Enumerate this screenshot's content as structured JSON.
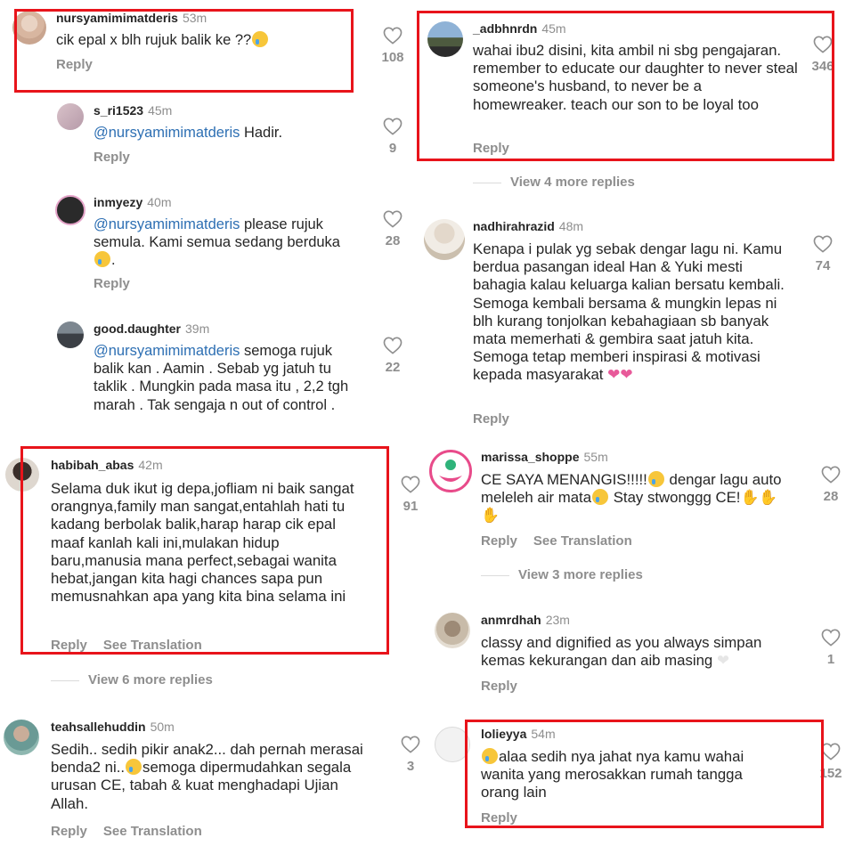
{
  "comments": {
    "c1": {
      "user": "nursyamimimatderis",
      "time": "53m",
      "text": "cik epal x blh rujuk balik ke ??",
      "reply": "Reply",
      "likes": "108"
    },
    "c2": {
      "user": "s_ri1523",
      "time": "45m",
      "mention": "@nursyamimimatderis",
      "text": " Hadir.",
      "reply": "Reply",
      "likes": "9"
    },
    "c3": {
      "user": "inmyezy",
      "time": "40m",
      "mention": "@nursyamimimatderis",
      "text": " please rujuk semula. Kami semua sedang berduka",
      "text2": ".",
      "reply": "Reply",
      "likes": "28"
    },
    "c4": {
      "user": "good.daughter",
      "time": "39m",
      "mention": "@nursyamimimatderis",
      "text": " semoga rujuk balik kan . Aamin . Sebab yg jatuh tu taklik . Mungkin pada masa itu , 2,2 tgh marah . Tak sengaja n out of control .",
      "reply": "Reply",
      "likes": "22"
    },
    "c5": {
      "user": "habibah_abas",
      "time": "42m",
      "text": "Selama duk ikut ig depa,jofliam ni baik sangat orangnya,family man sangat,entahlah hati tu kadang berbolak balik,harap harap cik epal maaf kanlah kali ini,mulakan hidup baru,manusia mana perfect,sebagai wanita hebat,jangan kita hagi chances sapa pun memusnahkan apa yang kita bina selama ini",
      "reply": "Reply",
      "see_translation": "See Translation",
      "likes": "91",
      "view_more": "View 6 more replies"
    },
    "c6": {
      "user": "teahsallehuddin",
      "time": "50m",
      "text": "Sedih.. sedih pikir anak2... dah pernah merasai benda2 ni..",
      "text2": "semoga dipermudahkan segala urusan CE, tabah & kuat menghadapi Ujian Allah.",
      "reply": "Reply",
      "see_translation": "See Translation",
      "likes": "3"
    },
    "c7": {
      "user": "_adbhnrdn",
      "time": "45m",
      "text": "wahai ibu2 disini, kita ambil ni sbg pengajaran. remember to educate our daughter to never steal someone's husband, to never be a homewreaker. teach our son to be loyal too",
      "reply": "Reply",
      "likes": "346",
      "view_more": "View 4 more replies"
    },
    "c8": {
      "user": "nadhirahrazid",
      "time": "48m",
      "text": "Kenapa i pulak yg sebak dengar lagu ni. Kamu berdua pasangan ideal Han & Yuki mesti bahagia kalau keluarga kalian bersatu kembali. Semoga kembali bersama & mungkin lepas ni blh kurang tonjolkan kebahagiaan sb banyak mata memerhati & gembira saat jatuh kita. Semoga tetap memberi inspirasi & motivasi kepada masyarakat",
      "reply": "Reply",
      "likes": "74"
    },
    "c9": {
      "user": "marissa_shoppe",
      "time": "55m",
      "text": "CE SAYA MENANGIS!!!!!",
      "text2": " dengar lagu auto meleleh air mata",
      "text3": " Stay stwonggg CE!",
      "reply": "Reply",
      "see_translation": "See Translation",
      "likes": "28",
      "view_more": "View 3 more replies"
    },
    "c10": {
      "user": "anmrdhah",
      "time": "23m",
      "text": "classy and dignified as you always simpan kemas kekurangan dan aib masing",
      "reply": "Reply",
      "likes": "1"
    },
    "c11": {
      "user": "lolieyya",
      "time": "54m",
      "text": "alaa sedih nya jahat nya kamu wahai wanita yang merosakkan rumah tangga orang lain",
      "reply": "Reply",
      "likes": "152"
    }
  },
  "colors": {
    "highlight": "#e8141b",
    "mention": "#2d6fb3",
    "muted": "#8e8e8e"
  }
}
